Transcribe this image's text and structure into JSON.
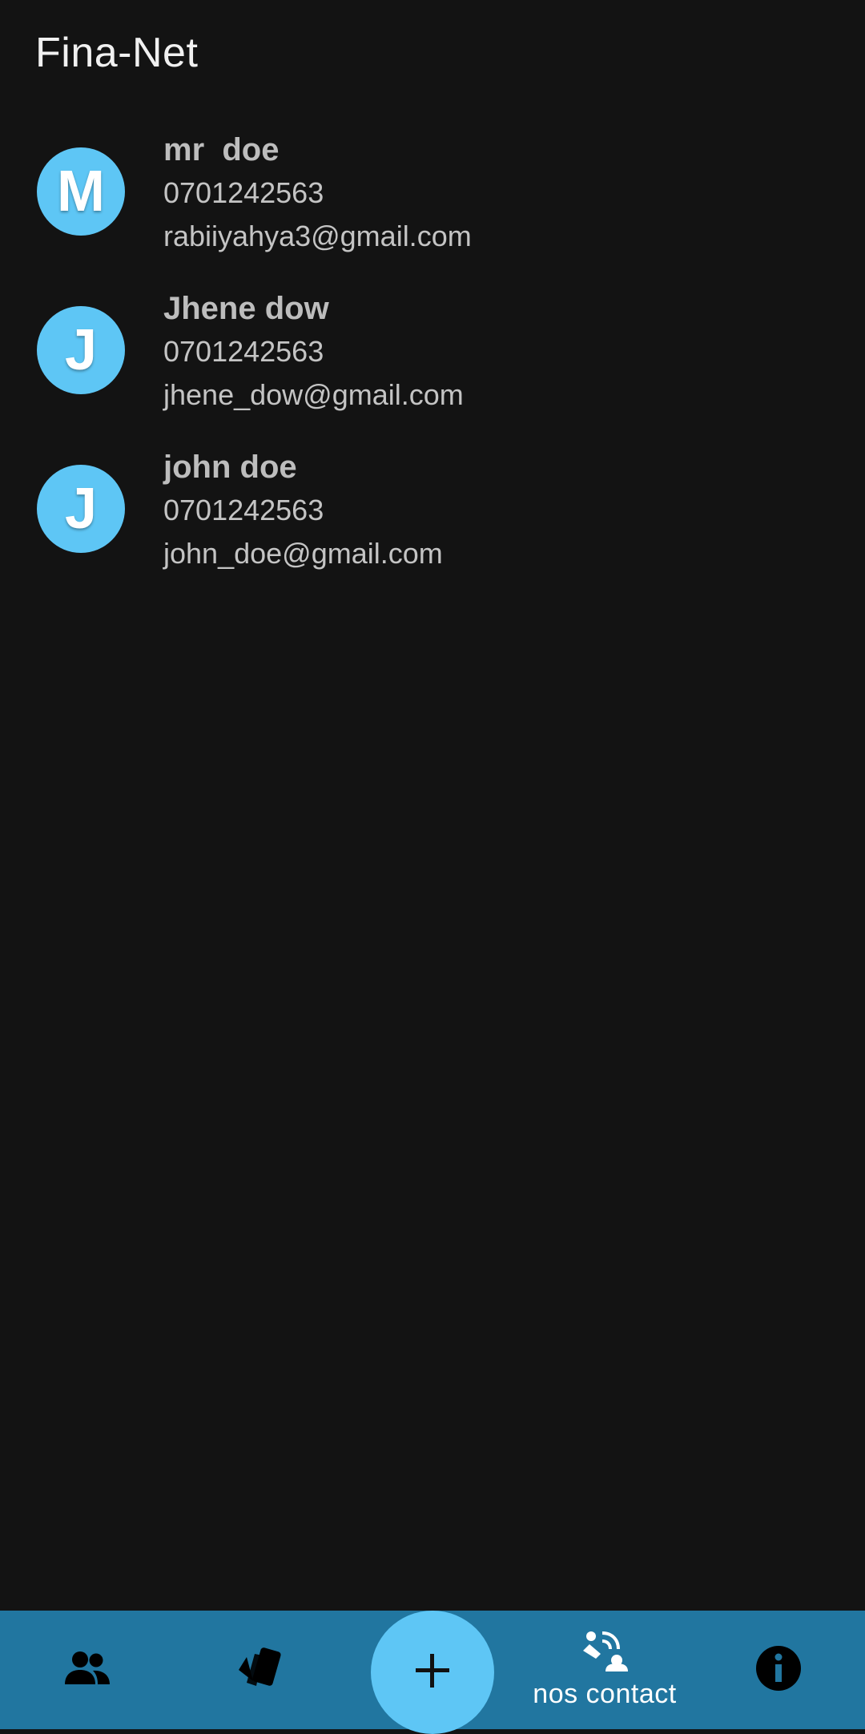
{
  "app": {
    "title": "Fina-Net"
  },
  "contacts": [
    {
      "initial": "M",
      "name": "mr  doe",
      "phone": "0701242563",
      "email": "rabiiyahya3@gmail.com"
    },
    {
      "initial": "J",
      "name": "Jhene dow",
      "phone": "0701242563",
      "email": "jhene_dow@gmail.com"
    },
    {
      "initial": "J",
      "name": "john doe",
      "phone": "0701242563",
      "email": "john_doe@gmail.com"
    }
  ],
  "bottom_nav": {
    "items": [
      {
        "icon": "people-icon",
        "label": ""
      },
      {
        "icon": "cards-icon",
        "label": ""
      },
      {
        "icon": "contact-us-icon",
        "label": "nos contact"
      },
      {
        "icon": "info-icon",
        "label": ""
      }
    ],
    "fab_icon": "plus-icon"
  },
  "colors": {
    "background": "#131313",
    "accent": "#5ec6f5",
    "bottom_bar": "#2176a0"
  }
}
